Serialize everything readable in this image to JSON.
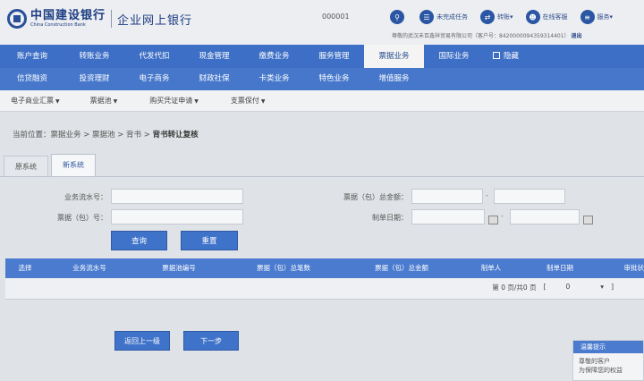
{
  "header": {
    "bank_name": "中国建设银行",
    "bank_name_en": "China Construction Bank",
    "product": "企业网上银行",
    "session_id": "000001",
    "tools": [
      {
        "icon": "search-icon",
        "label": ""
      },
      {
        "icon": "document-icon",
        "label": "未完成任务"
      },
      {
        "icon": "transfer-icon",
        "label": "转账"
      },
      {
        "icon": "user-icon",
        "label": "在线客服"
      },
      {
        "icon": "menu-icon",
        "label": "服务"
      }
    ],
    "user_info_prefix": "尊敬的武汉禾百鑫祥贸易有限公司（客户号：",
    "user_info_id": "8420000094359314401",
    "user_info_suffix": "）",
    "logout": "退出"
  },
  "nav": {
    "row1": [
      "账户查询",
      "转账业务",
      "代发代扣",
      "现金管理",
      "缴费业务",
      "服务管理",
      "票据业务",
      "国际业务",
      "隐藏"
    ],
    "row2": [
      "信贷融资",
      "投资理财",
      "电子商务",
      "财政社保",
      "卡类业务",
      "特色业务",
      "增值服务"
    ],
    "active": "票据业务"
  },
  "subnav": [
    "电子商业汇票",
    "票据池",
    "购买凭证申请",
    "支票保付"
  ],
  "breadcrumb": {
    "prefix": "当前位置：票据业务 > 票据池 > 背书 >",
    "current": "背书转让复核"
  },
  "tabs": [
    "原系统",
    "新系统"
  ],
  "active_tab": "新系统",
  "form": {
    "serial_label": "业务流水号：",
    "bill_no_label": "票据（包）号：",
    "amount_label": "票据（包）总金额：",
    "date_label": "制单日期：",
    "query_button": "查询",
    "reset_button": "重置"
  },
  "table": {
    "columns": [
      "选择",
      "业务流水号",
      "票据池编号",
      "票据（包）总笔数",
      "票据（包）总金额",
      "制单人",
      "制单日期",
      "审批状"
    ]
  },
  "pager": {
    "page_text": "第 0 页/共0 页",
    "bracket_open": "[",
    "page_input": "0",
    "bracket_close": "]"
  },
  "actions": {
    "back_button": "返回上一级",
    "next_button": "下一步"
  },
  "side": {
    "title": "温馨提示",
    "line1": "尊敬的客户",
    "line2": "为保障您的权益"
  },
  "colors": {
    "nav_primary": "#3d6fc6",
    "button": "#3f72c9",
    "brand": "#1b3c82"
  }
}
